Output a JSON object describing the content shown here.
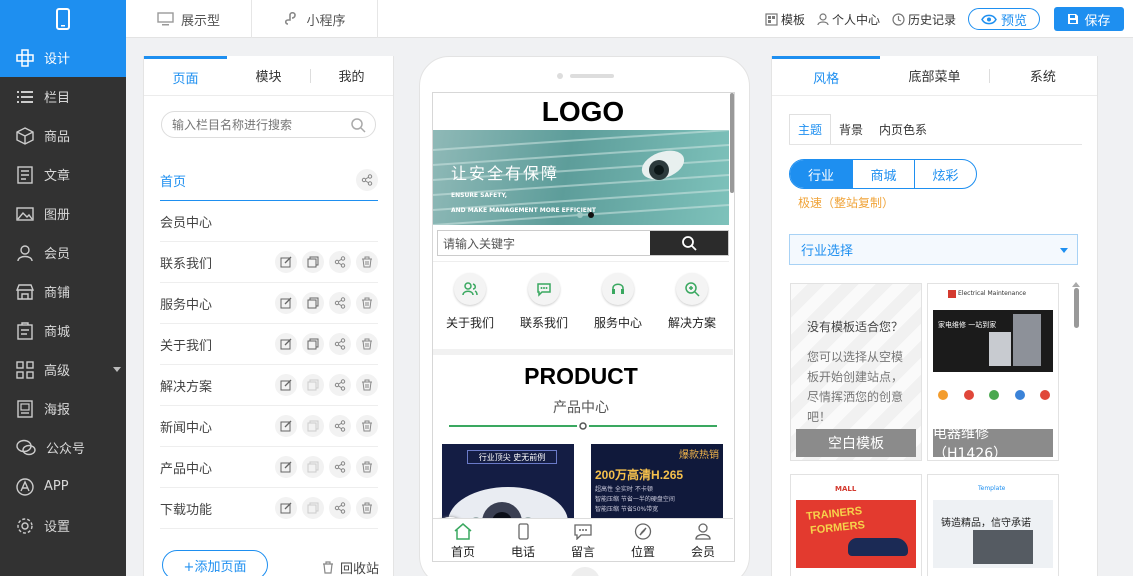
{
  "top": {
    "tabs": [
      {
        "label": "展示型",
        "icon": "monitor-icon"
      },
      {
        "label": "小程序",
        "icon": "mini-program-icon"
      }
    ],
    "actions": {
      "template": "模板",
      "personal": "个人中心",
      "history": "历史记录",
      "preview": "预览",
      "save": "保存"
    }
  },
  "sidebar": {
    "items": [
      {
        "label": "设计",
        "icon": "design-icon",
        "active": true
      },
      {
        "label": "栏目",
        "icon": "list-icon"
      },
      {
        "label": "商品",
        "icon": "box-icon"
      },
      {
        "label": "文章",
        "icon": "article-icon"
      },
      {
        "label": "图册",
        "icon": "gallery-icon"
      },
      {
        "label": "会员",
        "icon": "user-icon"
      },
      {
        "label": "商铺",
        "icon": "shop-icon"
      },
      {
        "label": "商城",
        "icon": "mall-icon"
      },
      {
        "label": "高级",
        "icon": "grid-icon",
        "has_arrow": true
      },
      {
        "label": "海报",
        "icon": "poster-icon"
      },
      {
        "label": "公众号",
        "icon": "wechat-icon"
      },
      {
        "label": "APP",
        "icon": "app-icon"
      },
      {
        "label": "设置",
        "icon": "settings-icon"
      }
    ]
  },
  "left_panel": {
    "tabs": [
      "页面",
      "模块",
      "我的"
    ],
    "search_placeholder": "输入栏目名称进行搜索",
    "pages": [
      {
        "label": "首页",
        "active": true
      },
      {
        "label": "会员中心"
      },
      {
        "label": "联系我们",
        "actions": true
      },
      {
        "label": "服务中心",
        "actions": true
      },
      {
        "label": "关于我们",
        "actions": true
      },
      {
        "label": "解决方案",
        "actions": true
      },
      {
        "label": "新闻中心",
        "actions": true
      },
      {
        "label": "产品中心",
        "actions": true
      },
      {
        "label": "下载功能",
        "actions": true
      }
    ],
    "add_page": "+添加页面",
    "recycle": "回收站"
  },
  "phone": {
    "logo": "LOGO",
    "banner_title": "让安全有保障",
    "banner_line1": "ENSURE SAFETY,",
    "banner_line2": "AND MAKE MANAGEMENT MORE EFFICIENT",
    "search_placeholder": "请输入关键字",
    "nav": [
      {
        "label": "关于我们",
        "icon": "people-icon"
      },
      {
        "label": "联系我们",
        "icon": "chat-icon"
      },
      {
        "label": "服务中心",
        "icon": "headset-icon"
      },
      {
        "label": "解决方案",
        "icon": "zoom-icon"
      }
    ],
    "product_title": "PRODUCT",
    "product_subtitle": "产品中心",
    "product1_text": "行业顶尖 史无前例",
    "product2_badge": "爆款热销",
    "product2_title": "200万高清H.265",
    "product2_l1": "超高性 全实时 不卡顿",
    "product2_l2": "智能压缩 节省一半的硬盘空间",
    "product2_l3": "智能压缩 节省50%带宽",
    "bottom": [
      {
        "label": "首页",
        "icon": "home-icon"
      },
      {
        "label": "电话",
        "icon": "phone-icon"
      },
      {
        "label": "留言",
        "icon": "message-icon"
      },
      {
        "label": "位置",
        "icon": "compass-icon"
      },
      {
        "label": "会员",
        "icon": "member-icon"
      }
    ]
  },
  "right_panel": {
    "tabs": [
      "风格",
      "底部菜单",
      "系统"
    ],
    "subtabs": [
      "主题",
      "背景",
      "内页色系"
    ],
    "segments": [
      "行业",
      "商城",
      "炫彩"
    ],
    "fast_copy": "极速（整站复制）",
    "industry_select": "行业选择",
    "blank_q": "没有模板适合您？",
    "blank_desc": "您可以选择从空模板开始创建站点，尽情挥洒您的创意吧！",
    "blank_label": "空白模板",
    "t1_label": "电器维修（H1426）",
    "t1_header": "Electrical Maintenance",
    "t1_banner": "家电维修 一站到家",
    "t2_header": "MALL",
    "t2_banner1": "TRAINERS",
    "t2_banner2": "FORMERS",
    "t3_header": "Template",
    "t3_banner": "铸造精品，信守承诺"
  },
  "colors": {
    "accent": "#1e8ff0",
    "sidebar_bg": "#323232",
    "green": "#3aa860"
  }
}
